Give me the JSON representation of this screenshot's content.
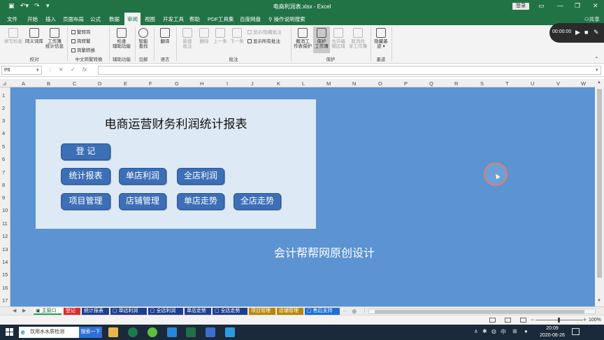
{
  "window": {
    "title": "电商利润表.xlsx  -  Excel",
    "login_label": "登录",
    "qa_save_icon": "save-icon",
    "qa_undo_icon": "undo-icon",
    "qa_redo_icon": "redo-icon",
    "qa_more_icon": "customize-icon"
  },
  "menu": {
    "tabs": [
      "文件",
      "开始",
      "插入",
      "页面布局",
      "公式",
      "数据",
      "审阅",
      "视图",
      "开发工具",
      "帮助",
      "PDF工具集",
      "百度网盘"
    ],
    "active_tab": "审阅",
    "search_hint": "操作说明搜索",
    "share_label": "共享"
  },
  "ribbon": {
    "groups": {
      "proofing": "校对",
      "chinese": "中文简繁转换",
      "accessibility": "辅助功能",
      "insights": "见解",
      "language": "语言",
      "comments": "批注",
      "protect": "保护",
      "ink": "墨迹"
    },
    "buttons": {
      "spellcheck": "拼写检查",
      "thesaurus": "同义词库",
      "workbook_stats": "工作簿\n统计信息",
      "to_traditional": "繁转简",
      "to_simplified": "简转繁",
      "convert": "简繁转换",
      "check_accessibility": "检查\n辅助功能",
      "smart_lookup": "智能\n查找",
      "translate": "翻译",
      "new_comment": "新建\n批注",
      "delete_comment": "删除",
      "prev_comment": "上一条",
      "next_comment": "下一条",
      "show_hide_comment": "显示/隐藏批注",
      "show_all_comments": "显示所有批注",
      "unprotect_sheet": "撤消工\n作表保护",
      "protect_workbook": "保护\n工作簿",
      "allow_edit_ranges": "允许编\n辑区域",
      "unshare_workbook": "取消共\n享工作簿",
      "hide_ink": "隐藏墨\n迹 ▾"
    }
  },
  "recorder": {
    "time": "00:00:00"
  },
  "formula_bar": {
    "name_box": "P6",
    "formula": ""
  },
  "grid": {
    "columns": [
      "A",
      "B",
      "C",
      "D",
      "E",
      "F",
      "G",
      "H",
      "I",
      "J",
      "K",
      "L",
      "M",
      "N",
      "O",
      "P",
      "Q",
      "R",
      "S",
      "T",
      "U",
      "V",
      "W"
    ],
    "rows": [
      "1",
      "2",
      "3",
      "4",
      "5",
      "6",
      "7",
      "8",
      "9",
      "10",
      "11",
      "12",
      "13",
      "14",
      "15",
      "16",
      "17"
    ]
  },
  "dashboard": {
    "title": "电商运营财务利润统计报表",
    "buttons": {
      "register": "登    记",
      "stats_report": "统计报表",
      "single_profit": "单店利润",
      "all_profit": "全店利润",
      "project_mgmt": "项目管理",
      "shop_mgmt": "店铺管理",
      "single_trend": "单店走势",
      "all_trend": "全店走势"
    },
    "credit": "会计帮帮网原创设计"
  },
  "sheet_tabs": [
    {
      "label": "主窗口",
      "color": "#2e9e54",
      "active": true
    },
    {
      "label": "登记",
      "color": "#d72f2f"
    },
    {
      "label": "统计报表",
      "color": "#1f3f8c"
    },
    {
      "label": "单店利润",
      "color": "#1f3f8c"
    },
    {
      "label": "全店利润",
      "color": "#1f3f8c"
    },
    {
      "label": "单店走势",
      "color": "#1f3f8c"
    },
    {
      "label": "全店走势",
      "color": "#1f3f8c"
    },
    {
      "label": "项目管理",
      "color": "#b8860b"
    },
    {
      "label": "店铺管理",
      "color": "#b8860b"
    },
    {
      "label": "售后支持",
      "color": "#1f6fd0"
    }
  ],
  "status_bar": {
    "zoom": "100%"
  },
  "taskbar": {
    "search_text": "饮用水水质检测",
    "search_button": "搜索一下",
    "ime": "中",
    "time": "20:09",
    "date": "2020-08-26"
  },
  "colors": {
    "excel_green": "#217346",
    "sheet_background": "#5b93d3",
    "panel": "#dde9f4",
    "button": "#3c6fb6"
  }
}
